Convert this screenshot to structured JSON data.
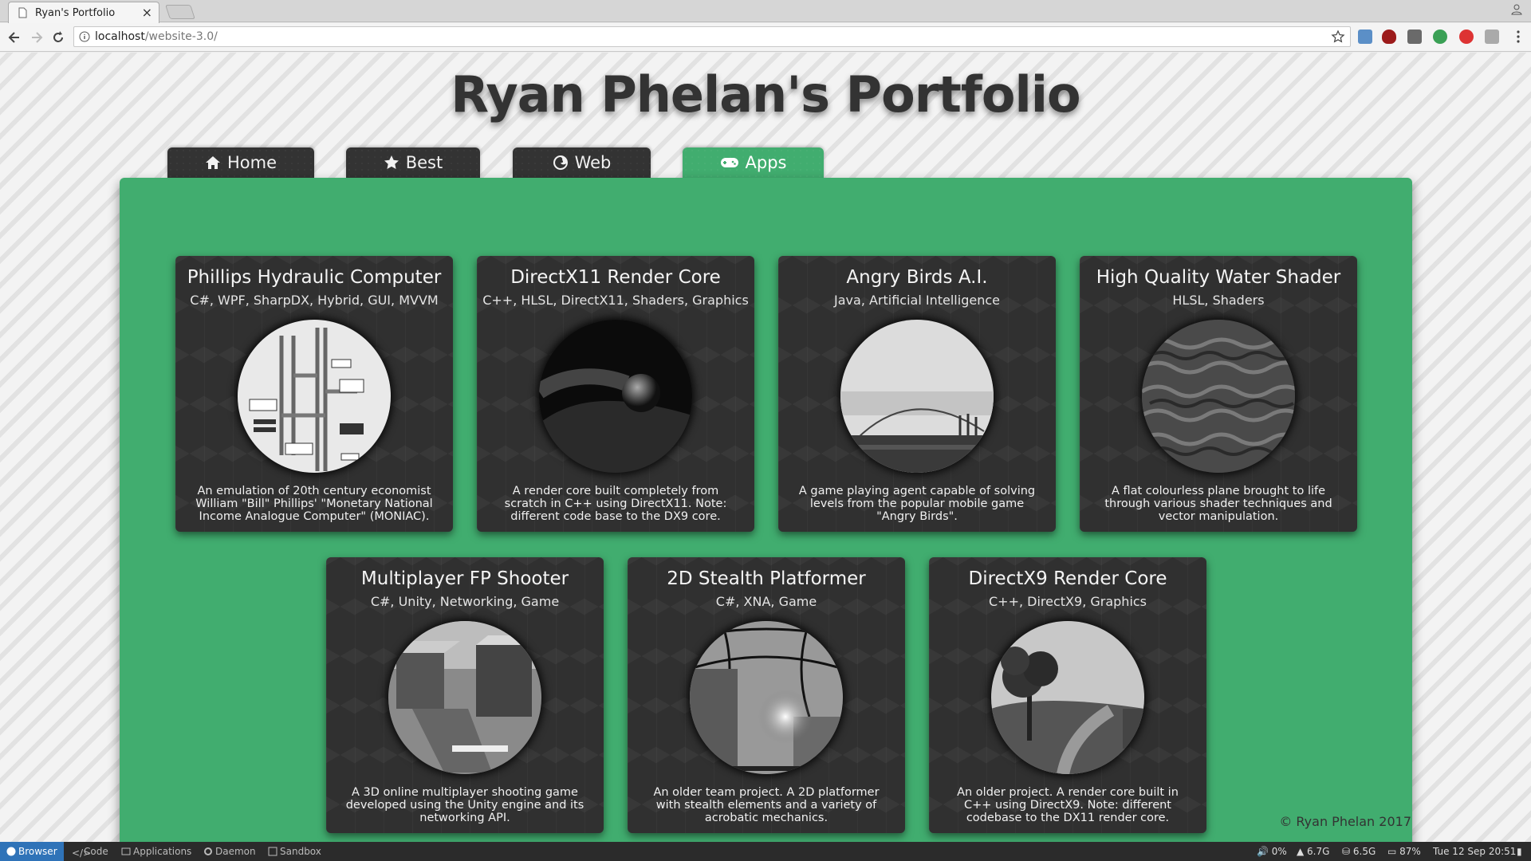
{
  "browser": {
    "tab_title": "Ryan's Portfolio",
    "tab_close": "×",
    "url_host": "localhost",
    "url_path": "/website-3.0/"
  },
  "page": {
    "title": "Ryan Phelan's Portfolio",
    "nav": [
      {
        "label": "Home",
        "icon": "home-icon"
      },
      {
        "label": "Best",
        "icon": "star-icon"
      },
      {
        "label": "Web",
        "icon": "firefox-icon"
      },
      {
        "label": "Apps",
        "icon": "gamepad-icon",
        "active": true
      }
    ],
    "accent_color": "#41ad6f",
    "card_color": "#303030",
    "cards": [
      {
        "title": "Phillips Hydraulic Computer",
        "tags": "C#, WPF, SharpDX, Hybrid, GUI, MVVM",
        "desc": "An emulation of 20th century economist William \"Bill\" Phillips' \"Monetary National Income Analogue Computer\" (MONIAC).",
        "thumb": "diagram"
      },
      {
        "title": "DirectX11 Render Core",
        "tags": "C++, HLSL, DirectX11, Shaders, Graphics",
        "desc": "A render core built completely from scratch in C++ using DirectX11. Note: different code base to the DX9 core.",
        "thumb": "sphere"
      },
      {
        "title": "Angry Birds A.I.",
        "tags": "Java, Artificial Intelligence",
        "desc": "A game playing agent capable of solving levels from the popular mobile game \"Angry Birds\".",
        "thumb": "trajectory"
      },
      {
        "title": "High Quality Water Shader",
        "tags": "HLSL, Shaders",
        "desc": "A flat colourless plane brought to life through various shader techniques and vector manipulation.",
        "thumb": "water"
      },
      {
        "title": "Multiplayer FP Shooter",
        "tags": "C#, Unity, Networking, Game",
        "desc": "A 3D online multiplayer shooting game developed using the Unity engine and its networking API.",
        "thumb": "rocks"
      },
      {
        "title": "2D Stealth Platformer",
        "tags": "C#, XNA, Game",
        "desc": "An older team project. A 2D platformer with stealth elements and a variety of acrobatic mechanics.",
        "thumb": "glow"
      },
      {
        "title": "DirectX9 Render Core",
        "tags": "C++, DirectX9, Graphics",
        "desc": "An older project. A render core built in C++ using DirectX9. Note: different codebase to the DX11 render core.",
        "thumb": "tree"
      }
    ],
    "footer": "© Ryan Phelan 2017"
  },
  "taskbar": {
    "items": [
      "Browser",
      "Code",
      "Applications",
      "Daemon",
      "Sandbox"
    ],
    "volume": "0%",
    "memory": "6.7G",
    "disk": "6.5G",
    "battery": "87%",
    "clock": "Tue 12 Sep 20:51"
  }
}
